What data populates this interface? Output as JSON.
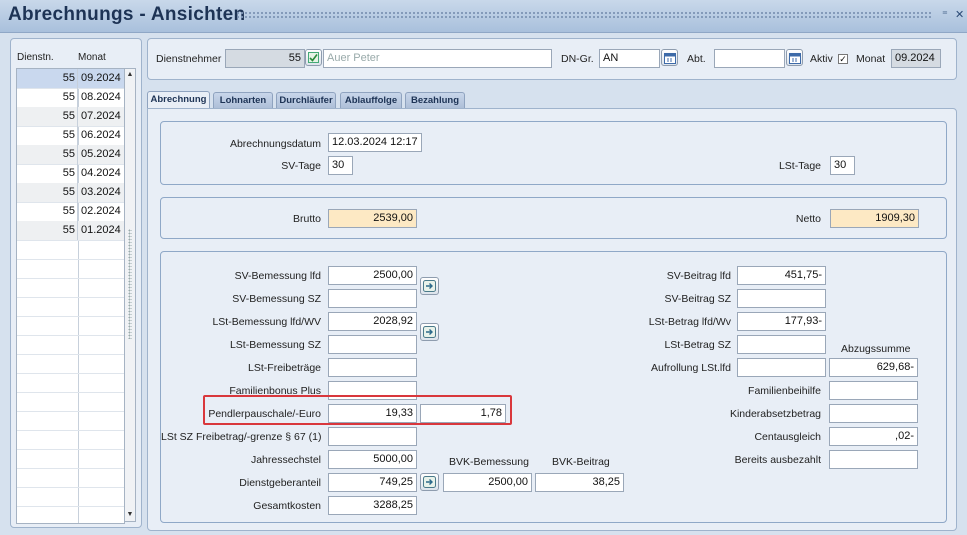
{
  "window": {
    "title": "Abrechnungs - Ansichten",
    "ctl_min": "⁼",
    "ctl_close": "✕"
  },
  "list": {
    "col_dienstn": "Dienstn.",
    "col_monat": "Monat",
    "rows": [
      {
        "dienstn": "55",
        "monat": "09.2024"
      },
      {
        "dienstn": "55",
        "monat": "08.2024"
      },
      {
        "dienstn": "55",
        "monat": "07.2024"
      },
      {
        "dienstn": "55",
        "monat": "06.2024"
      },
      {
        "dienstn": "55",
        "monat": "05.2024"
      },
      {
        "dienstn": "55",
        "monat": "04.2024"
      },
      {
        "dienstn": "55",
        "monat": "03.2024"
      },
      {
        "dienstn": "55",
        "monat": "02.2024"
      },
      {
        "dienstn": "55",
        "monat": "01.2024"
      }
    ]
  },
  "header": {
    "dienstnehmer_label": "Dienstnehmer",
    "dienstnehmer_nr": "55",
    "dienstnehmer_name": "Auer Peter",
    "dngr_label": "DN-Gr.",
    "dngr_value": "AN",
    "abt_label": "Abt.",
    "abt_value": "",
    "aktiv_label": "Aktiv",
    "aktiv_checked": true,
    "monat_label": "Monat",
    "monat_value": "09.2024"
  },
  "tabs": [
    "Abrechnung",
    "Lohnarten",
    "Durchläufer",
    "Ablauffolge",
    "Bezahlung"
  ],
  "section1": {
    "abrechnungsdatum_label": "Abrechnungsdatum",
    "abrechnungsdatum": "12.03.2024 12:17",
    "svtage_label": "SV-Tage",
    "svtage": "30",
    "lsttage_label": "LSt-Tage",
    "lsttage": "30"
  },
  "section2": {
    "brutto_label": "Brutto",
    "brutto": "2539,00",
    "netto_label": "Netto",
    "netto": "1909,30"
  },
  "section3": {
    "left": {
      "sv_bem_lfd_label": "SV-Bemessung lfd",
      "sv_bem_lfd": "2500,00",
      "sv_bem_sz_label": "SV-Bemessung SZ",
      "sv_bem_sz": "",
      "lst_bem_lfd_label": "LSt-Bemessung lfd/WV",
      "lst_bem_lfd": "2028,92",
      "lst_bem_sz_label": "LSt-Bemessung SZ",
      "lst_bem_sz": "",
      "lst_freib_label": "LSt-Freibeträge",
      "lst_freib": "",
      "fambonus_label": "Familienbonus Plus",
      "fambonus": "",
      "pendler_label": "Pendlerpauschale/-Euro",
      "pendler1": "19,33",
      "pendler2": "1,78",
      "lst_sz_label": "LSt SZ Freibetrag/-grenze § 67 (1)",
      "lst_sz": "",
      "jahressechstel_label": "Jahressechstel",
      "jahressechstel": "5000,00",
      "dg_anteil_label": "Dienstgeberanteil",
      "dg_anteil": "749,25",
      "gesamtkosten_label": "Gesamtkosten",
      "gesamtkosten": "3288,25",
      "bvk_bem_label": "BVK-Bemessung",
      "bvk_bem": "2500,00",
      "bvk_beitrag_label": "BVK-Beitrag",
      "bvk_beitrag": "38,25"
    },
    "right": {
      "sv_beitrag_lfd_label": "SV-Beitrag lfd",
      "sv_beitrag_lfd": "451,75-",
      "sv_beitrag_sz_label": "SV-Beitrag SZ",
      "sv_beitrag_sz": "",
      "lst_beitrag_lfd_label": "LSt-Betrag lfd/Wv",
      "lst_beitrag_lfd": "177,93-",
      "lst_beitrag_sz_label": "LSt-Betrag SZ",
      "lst_beitrag_sz": "",
      "abzugssumme_label": "Abzugssumme",
      "abzugssumme": "629,68-",
      "aufrollung_label": "Aufrollung LSt.lfd",
      "aufrollung": "",
      "familienbeihilfe_label": "Familienbeihilfe",
      "familienbeihilfe": "",
      "kinderabsetz_label": "Kinderabsetzbetrag",
      "kinderabsetz": "",
      "centausgleich_label": "Centausgleich",
      "centausgleich": ",02-",
      "bereits_label": "Bereits ausbezahlt",
      "bereits": ""
    }
  },
  "colors": {
    "highlight_box": "#d9373c",
    "field_yellow": "#fde9c4",
    "title_text": "#1d3355"
  }
}
